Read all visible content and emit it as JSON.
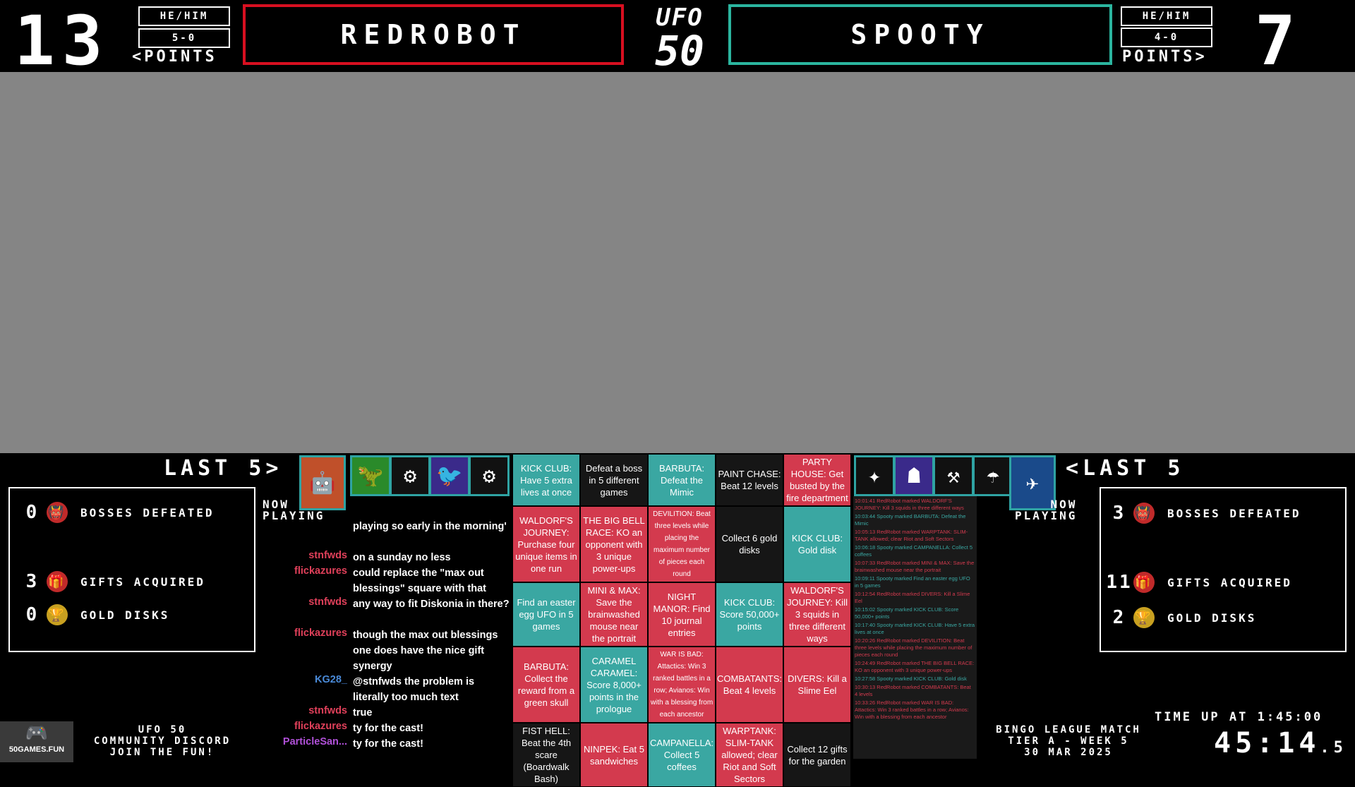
{
  "left_player": {
    "score": "13",
    "pronouns": "HE/HIM",
    "record": "5-0",
    "points_label": "<POINTS",
    "name": "REDROBOT",
    "color": "#d80f20"
  },
  "right_player": {
    "score": "7",
    "pronouns": "HE/HIM",
    "record": "4-0",
    "points_label": "POINTS>",
    "name": "SPOOTY",
    "color": "#2bb59f"
  },
  "logo": {
    "top": "UFO",
    "bottom": "50"
  },
  "left_panel": {
    "last5_label": "LAST 5>",
    "now_playing": "NOW\nPLAYING",
    "stats": [
      {
        "count": "0",
        "label": "BOSSES DEFEATED",
        "icon": "boss-icon"
      },
      {
        "count": "3",
        "label": "GIFTS ACQUIRED",
        "icon": "gift-icon"
      },
      {
        "count": "0",
        "label": "GOLD DISKS",
        "icon": "trophy-icon"
      }
    ]
  },
  "right_panel": {
    "last5_label": "<LAST 5",
    "now_playing": "NOW\nPLAYING",
    "stats": [
      {
        "count": "3",
        "label": "BOSSES DEFEATED",
        "icon": "boss-icon"
      },
      {
        "count": "11",
        "label": "GIFTS ACQUIRED",
        "icon": "gift-icon"
      },
      {
        "count": "2",
        "label": "GOLD DISKS",
        "icon": "trophy-icon"
      }
    ]
  },
  "chat": [
    {
      "user": "",
      "msg": "playing so early in the morning'"
    },
    {
      "user": "stnfwds",
      "msg": "on a sunday no less"
    },
    {
      "user": "flickazures",
      "msg": "could replace the \"max out blessings\" square with that"
    },
    {
      "user": "stnfwds",
      "msg": "any way to fit Diskonia in there?"
    },
    {
      "user": "flickazures",
      "msg": "though the max out blessings one does have the nice gift synergy"
    },
    {
      "user": "KG28_",
      "msg": "@stnfwds the problem is literally too much text"
    },
    {
      "user": "stnfwds",
      "msg": "true"
    },
    {
      "user": "flickazures",
      "msg": "ty for the cast!"
    },
    {
      "user": "ParticleSan...",
      "msg": "ty for the cast!"
    }
  ],
  "bingo": [
    {
      "text": "KICK CLUB: Have 5 extra lives at once",
      "c": "teal"
    },
    {
      "text": "Defeat a boss in 5 different games",
      "c": "dark"
    },
    {
      "text": "BARBUTA: Defeat the Mimic",
      "c": "teal"
    },
    {
      "text": "PAINT CHASE: Beat 12 levels",
      "c": "dark"
    },
    {
      "text": "PARTY HOUSE: Get busted by the fire department",
      "c": "red"
    },
    {
      "text": "WALDORF'S JOURNEY: Purchase four unique items in one run",
      "c": "red"
    },
    {
      "text": "THE BIG BELL RACE: KO an opponent with 3 unique power-ups",
      "c": "red"
    },
    {
      "text": "DEVILITION: Beat three levels while placing the maximum number of pieces each round",
      "c": "red"
    },
    {
      "text": "Collect 6 gold disks",
      "c": "dark"
    },
    {
      "text": "KICK CLUB: Gold disk",
      "c": "teal"
    },
    {
      "text": "Find an easter egg UFO in 5 games",
      "c": "teal"
    },
    {
      "text": "MINI & MAX: Save the brainwashed mouse near the portrait",
      "c": "red"
    },
    {
      "text": "NIGHT MANOR: Find 10 journal entries",
      "c": "red"
    },
    {
      "text": "KICK CLUB: Score 50,000+ points",
      "c": "teal"
    },
    {
      "text": "WALDORF'S JOURNEY: Kill 3 squids in three different ways",
      "c": "red"
    },
    {
      "text": "BARBUTA: Collect the reward from a green skull",
      "c": "red"
    },
    {
      "text": "CARAMEL CARAMEL: Score 8,000+ points in the prologue",
      "c": "teal"
    },
    {
      "text": "WAR IS BAD: Attactics: Win 3 ranked battles in a row; Avianos: Win with a blessing from each ancestor",
      "c": "red"
    },
    {
      "text": "COMBATANTS: Beat 4 levels",
      "c": "red"
    },
    {
      "text": "DIVERS: Kill a Slime Eel",
      "c": "red"
    },
    {
      "text": "FIST HELL: Beat the 4th scare (Boardwalk Bash)",
      "c": "dark"
    },
    {
      "text": "NINPEK: Eat 5 sandwiches",
      "c": "red"
    },
    {
      "text": "CAMPANELLA: Collect 5 coffees",
      "c": "teal"
    },
    {
      "text": "WARPTANK: SLIM-TANK allowed; clear Riot and Soft Sectors",
      "c": "red"
    },
    {
      "text": "Collect 12 gifts for the garden",
      "c": "dark"
    }
  ],
  "log": [
    {
      "t": "10:01:41 RedRobot marked WALDORF'S JOURNEY: Kill 3 squids in three different ways",
      "c": "r"
    },
    {
      "t": "10:03:44 Spooty marked BARBUTA: Defeat the Mimic",
      "c": "g"
    },
    {
      "t": "10:05:13 RedRobot marked WARPTANK: SLIM-TANK allowed; clear Riot and Soft Sectors",
      "c": "r"
    },
    {
      "t": "10:06:18 Spooty marked CAMPANELLA: Collect 5 coffees",
      "c": "g"
    },
    {
      "t": "10:07:33 RedRobot marked MINI & MAX: Save the brainwashed mouse near the portrait",
      "c": "r"
    },
    {
      "t": "10:09:11 Spooty marked Find an easter egg UFO in 5 games",
      "c": "g"
    },
    {
      "t": "10:12:54 RedRobot marked DIVERS: Kill a Slime Eel",
      "c": "r"
    },
    {
      "t": "10:15:02 Spooty marked KICK CLUB: Score 50,000+ points",
      "c": "g"
    },
    {
      "t": "10:17:40 Spooty marked KICK CLUB: Have 5 extra lives at once",
      "c": "g"
    },
    {
      "t": "10:20:26 RedRobot marked DEVILITION: Beat three levels while placing the maximum number of pieces each round",
      "c": "r"
    },
    {
      "t": "10:24:49 RedRobot marked THE BIG BELL RACE: KO an opponent with 3 unique power-ups",
      "c": "r"
    },
    {
      "t": "10:27:58 Spooty marked KICK CLUB: Gold disk",
      "c": "g"
    },
    {
      "t": "10:30:13 RedRobot marked COMBATANTS: Beat 4 levels",
      "c": "r"
    },
    {
      "t": "10:33:26 RedRobot marked WAR IS BAD: Attactics: Win 3 ranked battles in a row; Avianos: Win with a blessing from each ancestor",
      "c": "r"
    }
  ],
  "footer": {
    "discord_site": "50GAMES.FUN",
    "discord_lines": [
      "UFO 50",
      "COMMUNITY DISCORD",
      "JOIN THE FUN!"
    ],
    "match_lines": [
      "BINGO LEAGUE MATCH",
      "TIER A - WEEK 5",
      "30 MAR 2025"
    ],
    "time_up_label": "TIME UP AT 1:45:00",
    "timer": "45:14",
    "timer_suffix": ".5"
  },
  "colors": {
    "red": "#d33a4e",
    "teal": "#3aa7a2",
    "dark": "#161616"
  }
}
